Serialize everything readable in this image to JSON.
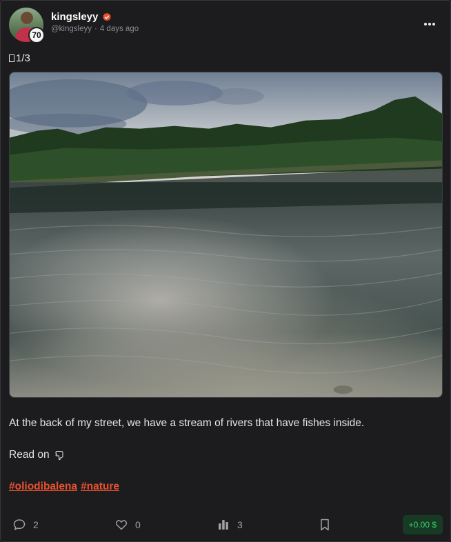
{
  "author": {
    "name": "kingsleyy",
    "handle": "@kingsleyy",
    "separator": "·",
    "time_ago": "4 days ago",
    "level": "70",
    "verified_color": "#e8512e"
  },
  "post": {
    "counter": "1/3",
    "caption": "At the back of my street, we have a stream of rivers that have fishes inside.",
    "read_on": "Read on",
    "tags": [
      "#oliodibalena",
      "#nature"
    ],
    "tag_color": "#e8512e"
  },
  "actions": {
    "comments": "2",
    "likes": "0",
    "views": "3",
    "reward": "+0.00 $"
  },
  "icons": {
    "menu": "more-horizontal-icon",
    "comment": "comment-bubble-icon",
    "like": "heart-icon",
    "stats": "bar-chart-icon",
    "bookmark": "bookmark-icon",
    "hand": "pointing-down-hand-icon"
  }
}
